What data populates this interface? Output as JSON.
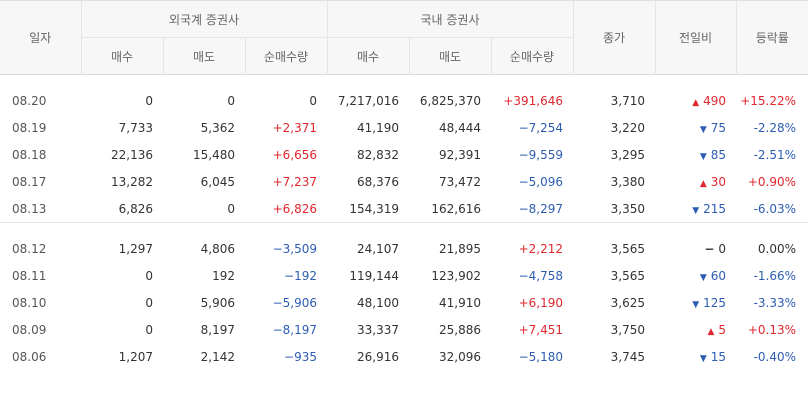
{
  "headers": {
    "date": "일자",
    "foreign_group": "외국계 증권사",
    "domestic_group": "국내 증권사",
    "close": "종가",
    "change": "전일비",
    "rate": "등락률",
    "buy": "매수",
    "sell": "매도",
    "net": "순매수량"
  },
  "colors": {
    "up": "#e0272f",
    "down": "#2d5db3"
  },
  "groups": [
    {
      "rows": [
        {
          "date": "08.20",
          "f_buy": "0",
          "f_sell": "0",
          "f_net": "0",
          "f_net_dir": "flat",
          "d_buy": "7,217,016",
          "d_sell": "6,825,370",
          "d_net": "+391,646",
          "d_net_dir": "up",
          "close": "3,710",
          "chg": "490",
          "chg_dir": "up",
          "rate": "+15.22%",
          "rate_dir": "up"
        },
        {
          "date": "08.19",
          "f_buy": "7,733",
          "f_sell": "5,362",
          "f_net": "+2,371",
          "f_net_dir": "up",
          "d_buy": "41,190",
          "d_sell": "48,444",
          "d_net": "−7,254",
          "d_net_dir": "down",
          "close": "3,220",
          "chg": "75",
          "chg_dir": "down",
          "rate": "-2.28%",
          "rate_dir": "down"
        },
        {
          "date": "08.18",
          "f_buy": "22,136",
          "f_sell": "15,480",
          "f_net": "+6,656",
          "f_net_dir": "up",
          "d_buy": "82,832",
          "d_sell": "92,391",
          "d_net": "−9,559",
          "d_net_dir": "down",
          "close": "3,295",
          "chg": "85",
          "chg_dir": "down",
          "rate": "-2.51%",
          "rate_dir": "down"
        },
        {
          "date": "08.17",
          "f_buy": "13,282",
          "f_sell": "6,045",
          "f_net": "+7,237",
          "f_net_dir": "up",
          "d_buy": "68,376",
          "d_sell": "73,472",
          "d_net": "−5,096",
          "d_net_dir": "down",
          "close": "3,380",
          "chg": "30",
          "chg_dir": "up",
          "rate": "+0.90%",
          "rate_dir": "up"
        },
        {
          "date": "08.13",
          "f_buy": "6,826",
          "f_sell": "0",
          "f_net": "+6,826",
          "f_net_dir": "up",
          "d_buy": "154,319",
          "d_sell": "162,616",
          "d_net": "−8,297",
          "d_net_dir": "down",
          "close": "3,350",
          "chg": "215",
          "chg_dir": "down",
          "rate": "-6.03%",
          "rate_dir": "down"
        }
      ]
    },
    {
      "rows": [
        {
          "date": "08.12",
          "f_buy": "1,297",
          "f_sell": "4,806",
          "f_net": "−3,509",
          "f_net_dir": "down",
          "d_buy": "24,107",
          "d_sell": "21,895",
          "d_net": "+2,212",
          "d_net_dir": "up",
          "close": "3,565",
          "chg": "0",
          "chg_dir": "flat",
          "rate": "0.00%",
          "rate_dir": "flat"
        },
        {
          "date": "08.11",
          "f_buy": "0",
          "f_sell": "192",
          "f_net": "−192",
          "f_net_dir": "down",
          "d_buy": "119,144",
          "d_sell": "123,902",
          "d_net": "−4,758",
          "d_net_dir": "down",
          "close": "3,565",
          "chg": "60",
          "chg_dir": "down",
          "rate": "-1.66%",
          "rate_dir": "down"
        },
        {
          "date": "08.10",
          "f_buy": "0",
          "f_sell": "5,906",
          "f_net": "−5,906",
          "f_net_dir": "down",
          "d_buy": "48,100",
          "d_sell": "41,910",
          "d_net": "+6,190",
          "d_net_dir": "up",
          "close": "3,625",
          "chg": "125",
          "chg_dir": "down",
          "rate": "-3.33%",
          "rate_dir": "down"
        },
        {
          "date": "08.09",
          "f_buy": "0",
          "f_sell": "8,197",
          "f_net": "−8,197",
          "f_net_dir": "down",
          "d_buy": "33,337",
          "d_sell": "25,886",
          "d_net": "+7,451",
          "d_net_dir": "up",
          "close": "3,750",
          "chg": "5",
          "chg_dir": "up",
          "rate": "+0.13%",
          "rate_dir": "up"
        },
        {
          "date": "08.06",
          "f_buy": "1,207",
          "f_sell": "2,142",
          "f_net": "−935",
          "f_net_dir": "down",
          "d_buy": "26,916",
          "d_sell": "32,096",
          "d_net": "−5,180",
          "d_net_dir": "down",
          "close": "3,745",
          "chg": "15",
          "chg_dir": "down",
          "rate": "-0.40%",
          "rate_dir": "down"
        }
      ]
    }
  ]
}
